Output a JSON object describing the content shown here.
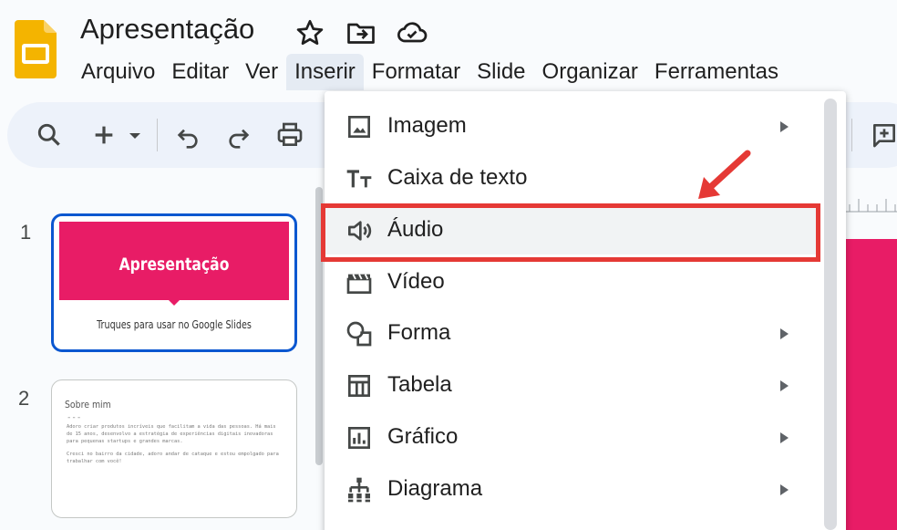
{
  "app": {
    "document_title": "Apresentação",
    "accent_color": "#e81c66",
    "logo_color": "#f4b400"
  },
  "title_icons": [
    "star-icon",
    "move-to-folder-icon",
    "cloud-saved-icon"
  ],
  "menubar": {
    "items": [
      "Arquivo",
      "Editar",
      "Ver",
      "Inserir",
      "Formatar",
      "Slide",
      "Organizar",
      "Ferramentas"
    ],
    "active": "Inserir"
  },
  "toolbar": {
    "icons": [
      "search-icon",
      "new-slide-icon",
      "new-slide-dropdown-icon",
      "undo-icon",
      "redo-icon",
      "print-icon",
      "add-comment-icon"
    ]
  },
  "filmstrip": {
    "slides": [
      {
        "number": "1",
        "title": "Apresentação",
        "subtitle": "Truques para usar no Google Slides",
        "selected": true
      },
      {
        "number": "2",
        "title": "Sobre mim",
        "separator": "---",
        "paragraphs": [
          "Adoro criar produtos incríveis que facilitam a vida das pessoas. Há mais de 15 anos, desenvolvo a estratégia de experiências digitais inovadoras para pequenas startups e grandes marcas.",
          "Cresci no bairro da cidade, adoro andar de cataque e estou empolgado para trabalhar com você!"
        ]
      }
    ]
  },
  "insert_menu": {
    "items": [
      {
        "label": "Imagem",
        "icon": "image-icon",
        "submenu": true
      },
      {
        "label": "Caixa de texto",
        "icon": "text-box-icon",
        "submenu": false
      },
      {
        "label": "Áudio",
        "icon": "audio-icon",
        "submenu": false,
        "highlighted": true
      },
      {
        "label": "Vídeo",
        "icon": "video-icon",
        "submenu": false
      },
      {
        "label": "Forma",
        "icon": "shape-icon",
        "submenu": true
      },
      {
        "label": "Tabela",
        "icon": "table-icon",
        "submenu": true
      },
      {
        "label": "Gráfico",
        "icon": "chart-icon",
        "submenu": true
      },
      {
        "label": "Diagrama",
        "icon": "diagram-icon",
        "submenu": true
      }
    ]
  },
  "annotation": {
    "color": "#e53935",
    "target": "Áudio"
  }
}
